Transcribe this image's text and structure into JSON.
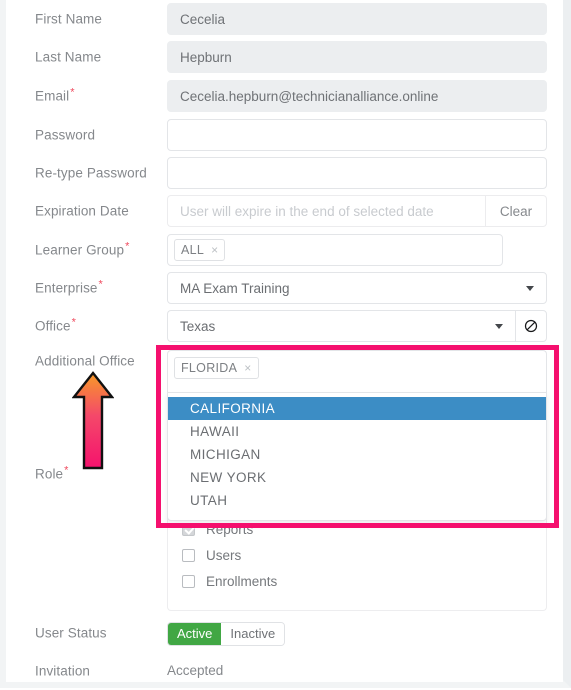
{
  "form": {
    "fields": [
      {
        "label": "First Name",
        "required": false,
        "type": "text-readonly",
        "value": "Cecelia"
      },
      {
        "label": "Last Name",
        "required": false,
        "type": "text-readonly",
        "value": "Hepburn"
      },
      {
        "label": "Email",
        "required": true,
        "type": "text-readonly",
        "value": "Cecelia.hepburn@technicianalliance.online"
      },
      {
        "label": "Password",
        "required": false,
        "type": "password",
        "value": ""
      },
      {
        "label": "Re-type Password",
        "required": false,
        "type": "password",
        "value": ""
      },
      {
        "label": "Expiration Date",
        "required": false,
        "type": "date",
        "value": "",
        "placeholder": "User will expire in the end of selected date",
        "button": "Clear"
      },
      {
        "label": "Learner Group",
        "required": true,
        "type": "tags",
        "tags": [
          "ALL"
        ],
        "button_icon": "plus-circle-icon"
      },
      {
        "label": "Enterprise",
        "required": true,
        "type": "select",
        "value": "MA Exam Training"
      },
      {
        "label": "Office",
        "required": true,
        "type": "select",
        "value": "Texas",
        "button_icon": "no-entry-icon"
      },
      {
        "label": "Additional Office",
        "required": false,
        "type": "multiselect",
        "tags": [
          "FLORIDA"
        ]
      },
      {
        "label": "Role",
        "required": true,
        "type": "select",
        "value": ""
      }
    ]
  },
  "additional_office": {
    "label": "Additional Office",
    "selected_tags": [
      "FLORIDA"
    ],
    "remove_glyph": "×",
    "options": [
      {
        "label": "CALIFORNIA",
        "highlighted": true
      },
      {
        "label": "HAWAII",
        "highlighted": false
      },
      {
        "label": "MICHIGAN",
        "highlighted": false
      },
      {
        "label": "NEW YORK",
        "highlighted": false
      },
      {
        "label": "UTAH",
        "highlighted": false
      }
    ],
    "highlight_border_color": "#f5106e",
    "option_highlight_color": "#3c8dc5"
  },
  "permissions": {
    "items": [
      {
        "label": "Reports",
        "checked": true,
        "disabled": true
      },
      {
        "label": "Users",
        "checked": false,
        "disabled": false
      },
      {
        "label": "Enrollments",
        "checked": false,
        "disabled": false
      }
    ]
  },
  "user_status": {
    "label": "User Status",
    "options": [
      "Active",
      "Inactive"
    ],
    "selected": "Active",
    "active_color": "#41a744"
  },
  "invitation": {
    "label": "Invitation",
    "value": "Accepted"
  },
  "annotation": {
    "arrow": "up-arrow-annotation",
    "gradient_top": "#F89A28",
    "gradient_bottom": "#F5126D"
  }
}
